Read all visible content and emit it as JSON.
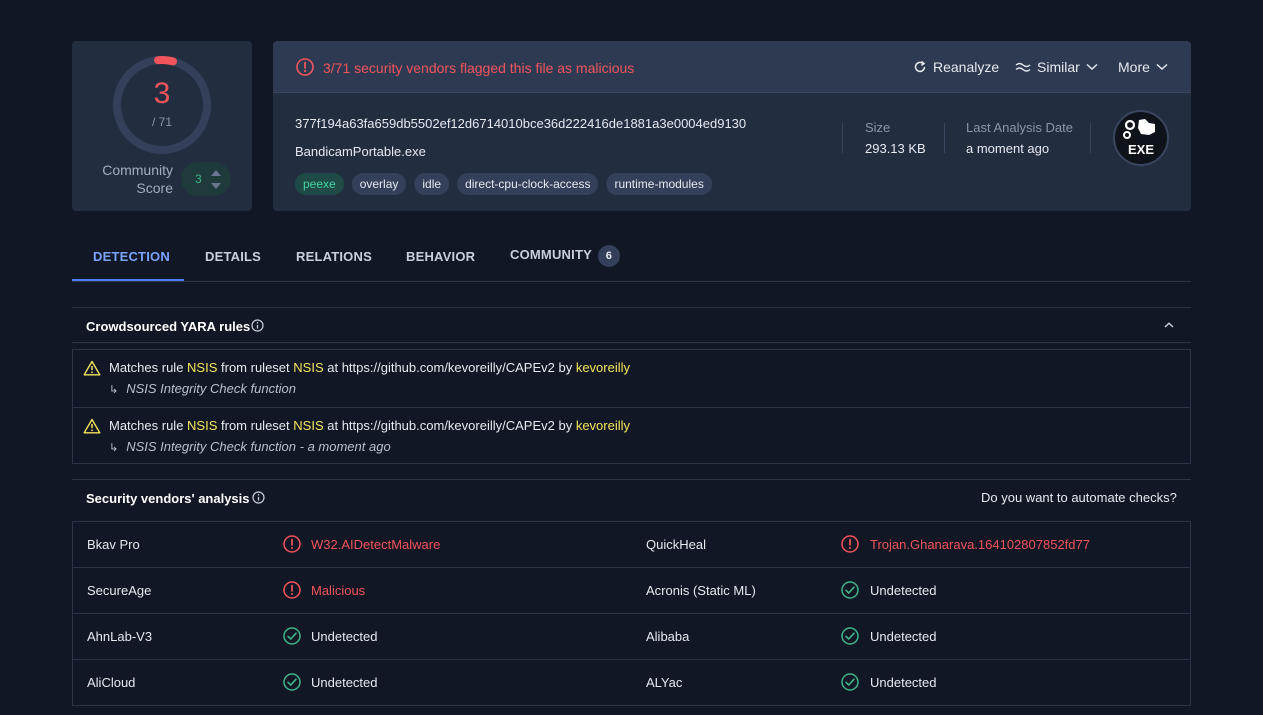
{
  "score": {
    "value": "3",
    "total": "/ 71",
    "community_label_line1": "Community",
    "community_label_line2": "Score",
    "community_value": "3"
  },
  "summary": {
    "alert": "3/71 security vendors flagged this file as malicious",
    "actions": {
      "reanalyze": "Reanalyze",
      "similar": "Similar",
      "more": "More"
    },
    "hash": "377f194a63fa659db5502ef12d6714010bce36d222416de1881a3e0004ed9130",
    "filename": "BandicamPortable.exe",
    "tags": [
      "peexe",
      "overlay",
      "idle",
      "direct-cpu-clock-access",
      "runtime-modules"
    ],
    "size_label": "Size",
    "size_value": "293.13 KB",
    "date_label": "Last Analysis Date",
    "date_value": "a moment ago",
    "file_type": "EXE"
  },
  "tabs": [
    {
      "label": "DETECTION"
    },
    {
      "label": "DETAILS"
    },
    {
      "label": "RELATIONS"
    },
    {
      "label": "BEHAVIOR"
    },
    {
      "label": "COMMUNITY",
      "badge": "6"
    }
  ],
  "yara": {
    "title": "Crowdsourced YARA rules",
    "rows": [
      {
        "prefix": "Matches rule",
        "rule": "NSIS",
        "mid": "from ruleset",
        "ruleset": "NSIS",
        "at": "at https://github.com/kevoreilly/CAPEv2 by",
        "author": "kevoreilly",
        "sub": "NSIS Integrity Check function"
      },
      {
        "prefix": "Matches rule",
        "rule": "NSIS",
        "mid": "from ruleset",
        "ruleset": "NSIS",
        "at": "at https://github.com/kevoreilly/CAPEv2 by",
        "author": "kevoreilly",
        "sub": "NSIS Integrity Check function - a moment ago"
      }
    ]
  },
  "vendors": {
    "title": "Security vendors' analysis",
    "automate": "Do you want to automate checks?",
    "rows": [
      {
        "left": {
          "name": "Bkav Pro",
          "result": "W32.AIDetectMalware",
          "status": "malicious"
        },
        "right": {
          "name": "QuickHeal",
          "result": "Trojan.Ghanarava.164102807852fd77",
          "status": "malicious"
        }
      },
      {
        "left": {
          "name": "SecureAge",
          "result": "Malicious",
          "status": "malicious"
        },
        "right": {
          "name": "Acronis (Static ML)",
          "result": "Undetected",
          "status": "undetected"
        }
      },
      {
        "left": {
          "name": "AhnLab-V3",
          "result": "Undetected",
          "status": "undetected"
        },
        "right": {
          "name": "Alibaba",
          "result": "Undetected",
          "status": "undetected"
        }
      },
      {
        "left": {
          "name": "AliCloud",
          "result": "Undetected",
          "status": "undetected"
        },
        "right": {
          "name": "ALYac",
          "result": "Undetected",
          "status": "undetected"
        }
      }
    ]
  },
  "colors": {
    "malicious": "#f2545b",
    "undetected": "#3fb58a",
    "accent": "#4d7cff",
    "highlight": "#f5e55c"
  }
}
